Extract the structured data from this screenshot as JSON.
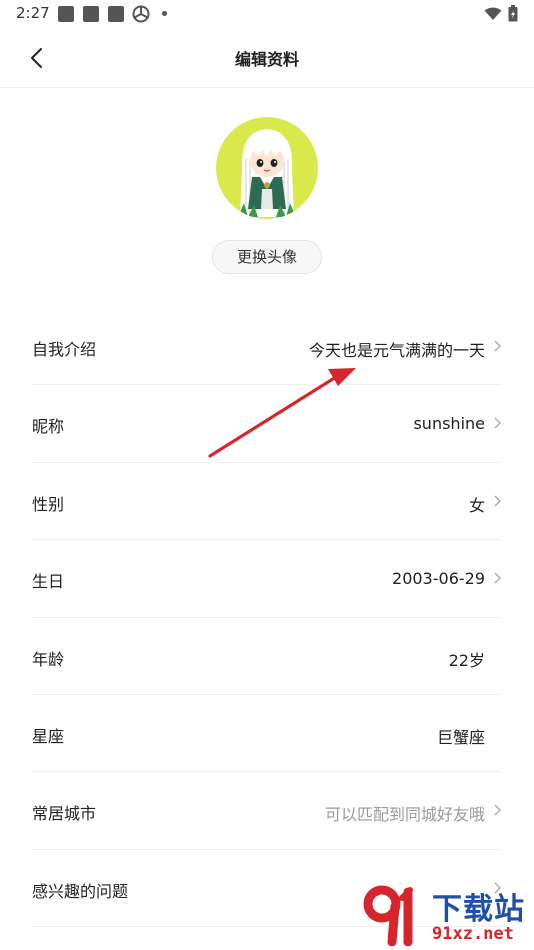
{
  "status_bar": {
    "time": "2:27",
    "icons": [
      "notification-square-icon",
      "notification-square-icon",
      "notification-square-icon",
      "aperture-icon",
      "more-dot-icon",
      "wifi-icon",
      "battery-icon"
    ]
  },
  "header": {
    "title": "编辑资料",
    "back_icon": "chevron-left-icon"
  },
  "profile": {
    "change_avatar_label": "更换头像",
    "avatar_bg_color": "#d9e84a"
  },
  "fields": [
    {
      "label": "自我介绍",
      "value": "今天也是元气满满的一天",
      "muted": false,
      "has_chevron": true
    },
    {
      "label": "昵称",
      "value": "sunshine",
      "muted": false,
      "has_chevron": true
    },
    {
      "label": "性别",
      "value": "女",
      "muted": false,
      "has_chevron": true
    },
    {
      "label": "生日",
      "value": "2003-06-29",
      "muted": false,
      "has_chevron": true
    },
    {
      "label": "年龄",
      "value": "22岁",
      "muted": false,
      "has_chevron": false
    },
    {
      "label": "星座",
      "value": "巨蟹座",
      "muted": false,
      "has_chevron": false
    },
    {
      "label": "常居城市",
      "value": "可以匹配到同城好友哦",
      "muted": true,
      "has_chevron": true
    },
    {
      "label": "感兴趣的问题",
      "value": "",
      "muted": false,
      "has_chevron": true
    }
  ],
  "annotation": {
    "color": "#d6262b"
  },
  "watermark": {
    "brand_top": "下载站",
    "brand_bottom": "91xz.net",
    "primary_color": "#1f4fa8",
    "accent_color": "#d6262b"
  }
}
